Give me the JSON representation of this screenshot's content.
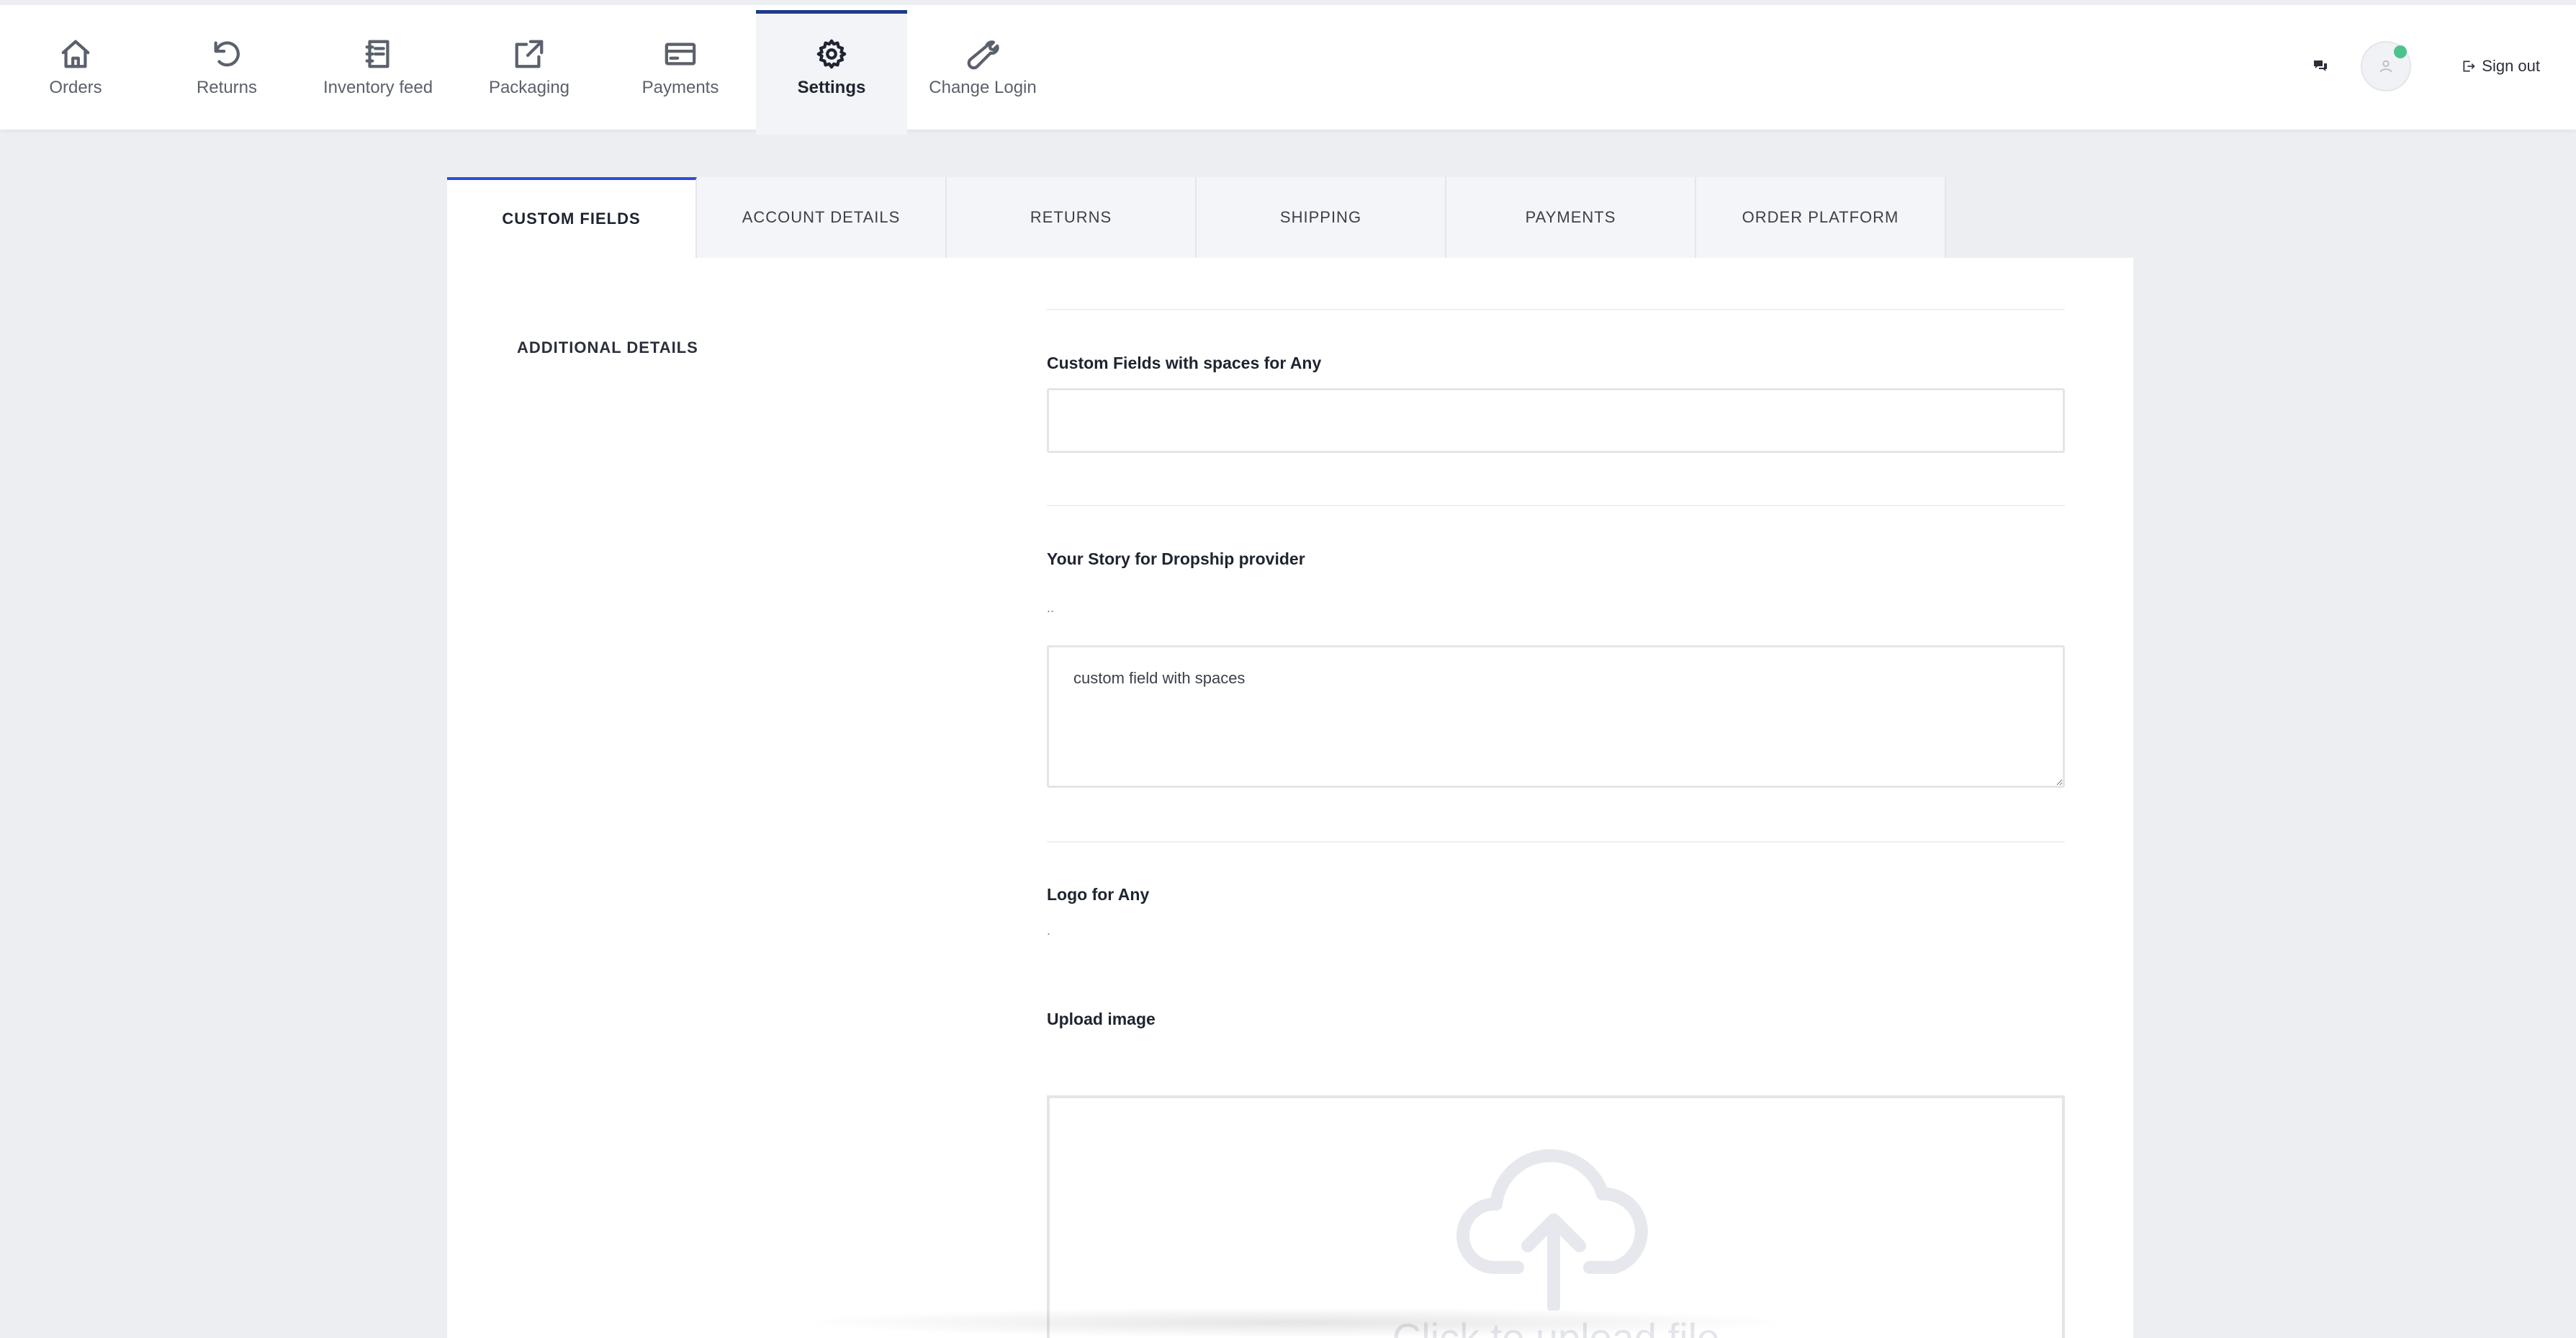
{
  "nav": {
    "items": [
      {
        "label": "Orders",
        "icon": "home-icon"
      },
      {
        "label": "Returns",
        "icon": "undo-icon"
      },
      {
        "label": "Inventory feed",
        "icon": "notebook-icon"
      },
      {
        "label": "Packaging",
        "icon": "external-link-icon"
      },
      {
        "label": "Payments",
        "icon": "credit-card-icon"
      },
      {
        "label": "Settings",
        "icon": "gear-icon",
        "active": true
      },
      {
        "label": "Change Login",
        "icon": "wrench-icon"
      }
    ]
  },
  "header": {
    "sign_out_label": "Sign out",
    "status_color": "#4cc38a",
    "accent_color": "#1f3a8a"
  },
  "tabs": [
    {
      "label": "CUSTOM FIELDS",
      "active": true
    },
    {
      "label": "ACCOUNT DETAILS"
    },
    {
      "label": "RETURNS"
    },
    {
      "label": "SHIPPING"
    },
    {
      "label": "PAYMENTS"
    },
    {
      "label": "ORDER PLATFORM"
    }
  ],
  "section": {
    "title": "ADDITIONAL DETAILS"
  },
  "fields": {
    "custom_fields": {
      "label": "Custom Fields with spaces for Any",
      "value": ""
    },
    "story": {
      "label": "Your Story for Dropship provider",
      "help": "..",
      "value": "custom field with spaces"
    },
    "logo": {
      "label": "Logo for Any",
      "help": "."
    },
    "upload": {
      "label": "Upload image",
      "dropzone_text": "Click to upload file"
    }
  }
}
